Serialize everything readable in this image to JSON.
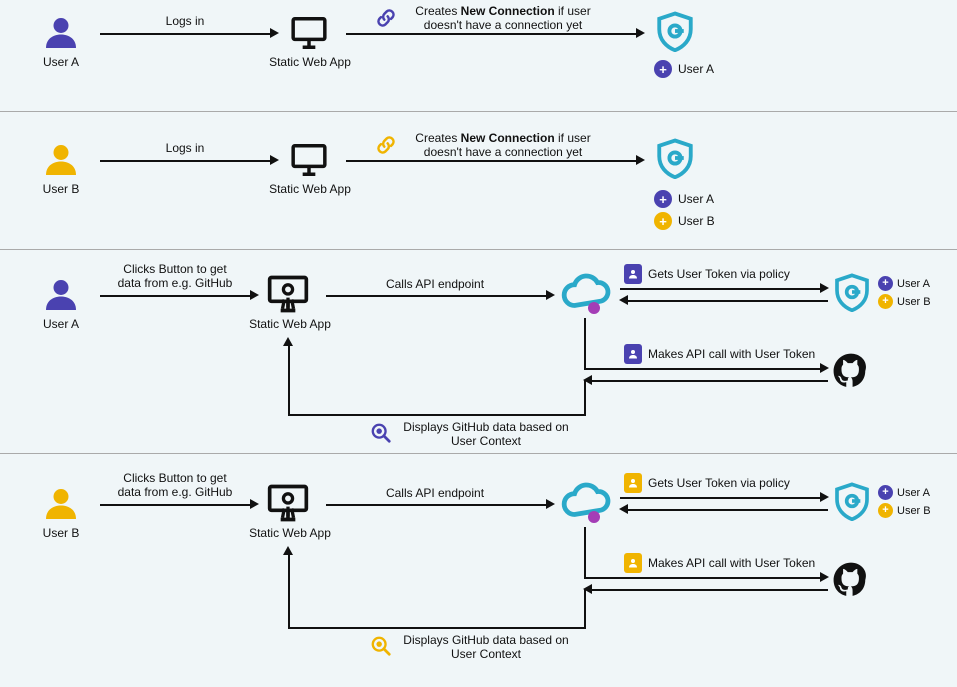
{
  "colors": {
    "purple": "#4a42b0",
    "yellow": "#f0b400",
    "teal": "#2aa9c9",
    "magenta": "#a43db6",
    "dark": "#111111"
  },
  "panels": [
    {
      "user_label": "User A",
      "user_color": "purple",
      "action_label": "Logs in",
      "app_label": "Static Web App",
      "connection_prefix": "Creates ",
      "connection_bold": "New Connection",
      "connection_suffix": " if user doesn't have a connection yet",
      "link_color": "purple",
      "registered_users": [
        {
          "label": "User A",
          "color": "purple"
        }
      ]
    },
    {
      "user_label": "User B",
      "user_color": "yellow",
      "action_label": "Logs in",
      "app_label": "Static Web App",
      "connection_prefix": "Creates ",
      "connection_bold": "New Connection",
      "connection_suffix": " if user doesn't have a connection yet",
      "link_color": "yellow",
      "registered_users": [
        {
          "label": "User A",
          "color": "purple"
        },
        {
          "label": "User B",
          "color": "yellow"
        }
      ]
    },
    {
      "user_label": "User A",
      "user_color": "purple",
      "action_label": "Clicks Button to get data from e.g. GitHub",
      "app_label": "Static Web App",
      "api_label": "Calls API endpoint",
      "token_label": "Gets User Token via policy",
      "apicall_label": "Makes API call with User Token",
      "display_label": "Displays GitHub data based on User Context",
      "card_color": "purple",
      "registered_users": [
        {
          "label": "User A",
          "color": "purple"
        },
        {
          "label": "User B",
          "color": "yellow"
        }
      ]
    },
    {
      "user_label": "User B",
      "user_color": "yellow",
      "action_label": "Clicks Button to get data from e.g. GitHub",
      "app_label": "Static Web App",
      "api_label": "Calls API endpoint",
      "token_label": "Gets User Token via policy",
      "apicall_label": "Makes API call with User Token",
      "display_label": "Displays GitHub data based on User Context",
      "card_color": "yellow",
      "registered_users": [
        {
          "label": "User A",
          "color": "purple"
        },
        {
          "label": "User B",
          "color": "yellow"
        }
      ]
    }
  ]
}
